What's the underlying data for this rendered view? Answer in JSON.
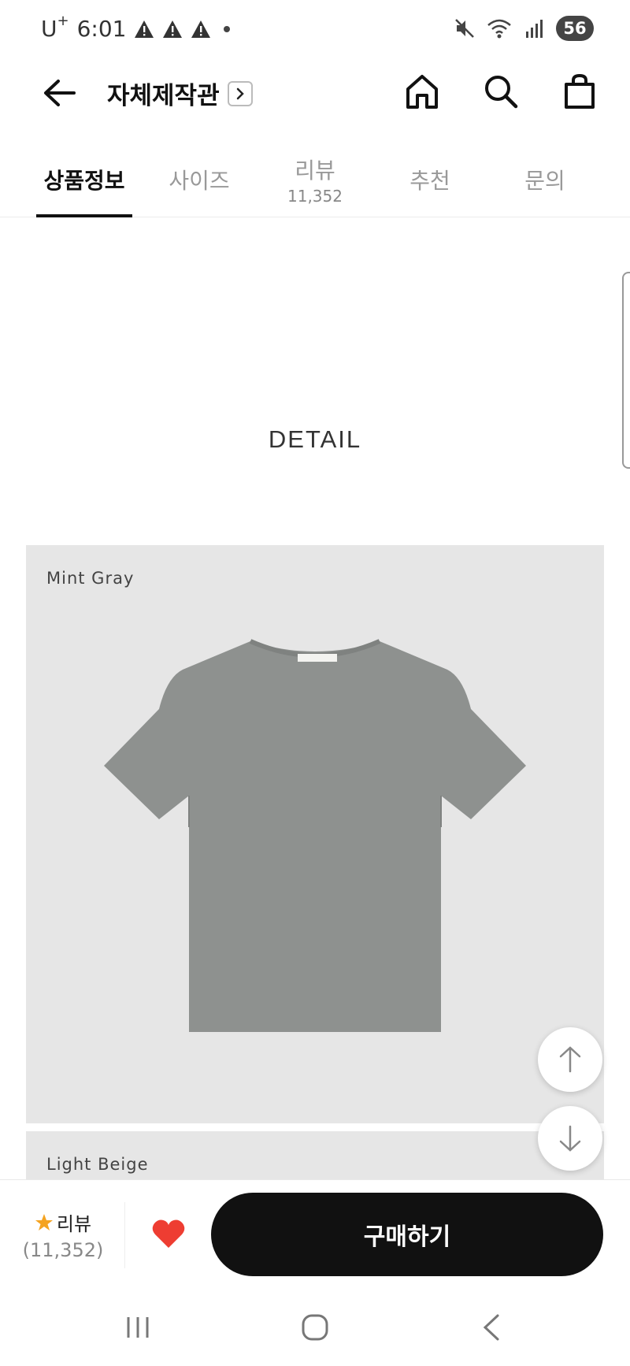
{
  "status": {
    "carrier": "U",
    "carrier_sup": "+",
    "time": "6:01",
    "battery": "56"
  },
  "header": {
    "store_title": "자체제작관"
  },
  "tabs": [
    {
      "label": "상품정보",
      "sub": ""
    },
    {
      "label": "사이즈",
      "sub": ""
    },
    {
      "label": "리뷰",
      "sub": "11,352"
    },
    {
      "label": "추천",
      "sub": ""
    },
    {
      "label": "문의",
      "sub": ""
    }
  ],
  "content": {
    "detail_heading": "DETAIL",
    "panels": [
      {
        "color_label": "Mint Gray",
        "shirt_color": "#8e918f"
      },
      {
        "color_label": "Light Beige"
      }
    ]
  },
  "buybar": {
    "review_label": "리뷰",
    "review_count": "(11,352)",
    "buy_label": "구매하기",
    "heart_color": "#ee3d32",
    "star_color": "#f4a321"
  }
}
